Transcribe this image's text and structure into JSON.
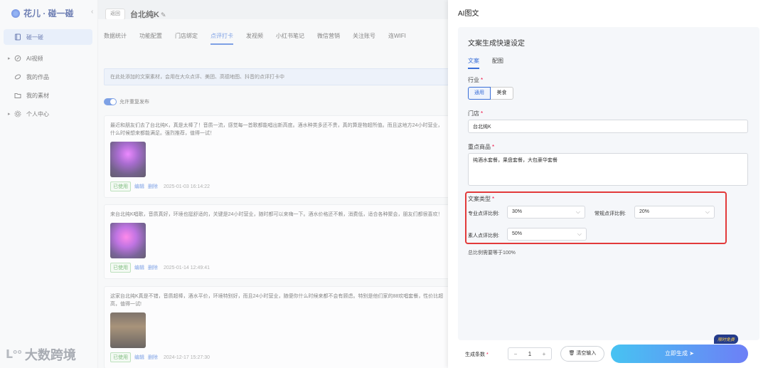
{
  "sidebar": {
    "logo": "花儿 · 碰一碰",
    "items": [
      {
        "label": "碰一碰",
        "icon": "book-icon",
        "active": true,
        "caret": false
      },
      {
        "label": "AI视频",
        "icon": "edit-icon",
        "active": false,
        "caret": true
      },
      {
        "label": "我的作品",
        "icon": "link-icon",
        "active": false,
        "caret": false
      },
      {
        "label": "我的素材",
        "icon": "folder-icon",
        "active": false,
        "caret": false
      },
      {
        "label": "个人中心",
        "icon": "gear-icon",
        "active": false,
        "caret": true
      }
    ]
  },
  "main": {
    "back_label": "返回",
    "store_title": "台北纯K",
    "tabs": [
      "数据统计",
      "功能配置",
      "门店绑定",
      "点评打卡",
      "发视频",
      "小红书笔记",
      "微信营销",
      "关注账号",
      "连WIFI"
    ],
    "active_tab": 3,
    "info_text": "在此处添加的文案素材，会用在大众点评、美团、高德地图、抖音的点评打卡中",
    "toggle_label": "允许重复发布",
    "cards": [
      {
        "text": "最近和朋友们去了台北纯K，真是太棒了！音质一流，感觉每一首歌都能唱出新高度。酒水种类多还不贵，真的算是物超所值。而且这地方24小时营业，什么时候想来都能满足。强烈推荐，值得一试！",
        "badge": "已使用",
        "edit": "编辑",
        "delete": "删除",
        "time": "2025-01-03 16:14:22"
      },
      {
        "text": "来台北纯K唱歌，音质真好，环境也挺舒适的，关键是24小时营业，随时都可以来嗨一下。酒水价格还不赖，消费低，适合各种聚会，朋友们都很喜欢！",
        "badge": "已使用",
        "edit": "编辑",
        "delete": "删除",
        "time": "2025-01-14 12:49:41"
      },
      {
        "text": "这家台北纯K真是不错，音质超棒，酒水平价，环境特别好，而且24小时营业，随便你什么时候来都不会有顾虑。特别是他们家的88欢唱套餐，性价比超高，值得一试!",
        "badge": "已使用",
        "edit": "编辑",
        "delete": "删除",
        "time": "2024-12-17 15:27:30"
      }
    ]
  },
  "watermark": "大数跨境",
  "drawer": {
    "title": "AI图文",
    "section_title": "文案生成快速设定",
    "sub_tabs": [
      "文案",
      "配图"
    ],
    "industry_label": "行业",
    "industry_options": [
      "通用",
      "美食"
    ],
    "store_label": "门店",
    "store_value": "台北纯K",
    "product_label": "重点商品",
    "product_value": "纯酒水套餐，果盘套餐，大包豪华套餐",
    "type_label": "文案类型",
    "ratios": [
      {
        "label": "专业点评比例:",
        "value": "30%"
      },
      {
        "label": "常规点评比例:",
        "value": "20%"
      },
      {
        "label": "素人点评比例:",
        "value": "50%"
      }
    ],
    "hint": "总比例需要等于100%",
    "count_label": "生成条数",
    "count_value": "1",
    "minus": "−",
    "plus": "+",
    "clear_label": "清空输入",
    "generate_label": "立即生成",
    "free_badge": "限时免费"
  }
}
